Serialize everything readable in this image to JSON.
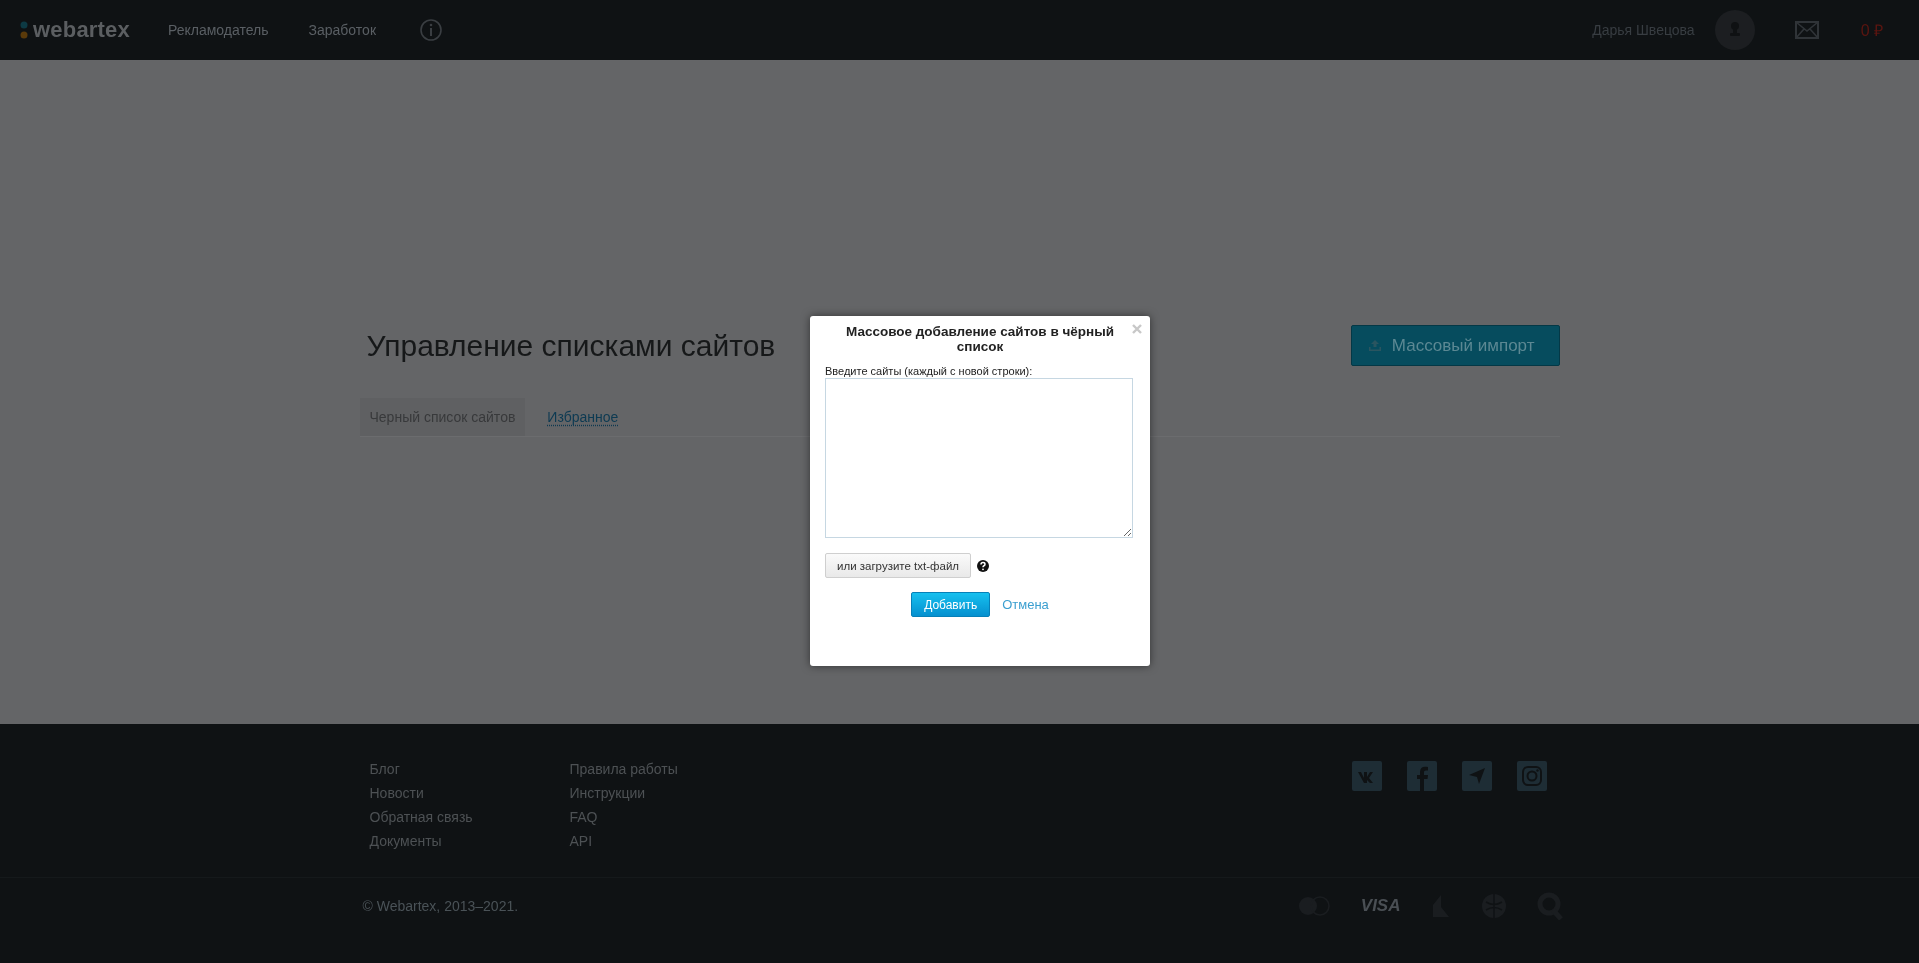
{
  "header": {
    "logo": "webartex",
    "nav": [
      {
        "label": "Рекламодатель"
      },
      {
        "label": "Заработок"
      }
    ],
    "user_name": "Дарья Швецова",
    "balance": "0 ₽"
  },
  "page": {
    "title": "Управление списками сайтов",
    "import_button": "Массовый импорт",
    "tabs": [
      {
        "label": "Черный список сайтов",
        "selected": true
      },
      {
        "label": "Избранное",
        "selected": false
      }
    ]
  },
  "dialog": {
    "title": "Массовое добавление сайтов в чёрный список",
    "field_label": "Введите сайты (каждый с новой строки):",
    "upload_button": "или загрузите txt-файл",
    "submit_button": "Добавить",
    "cancel_link": "Отмена"
  },
  "footer": {
    "columns": [
      [
        "Блог",
        "Новости",
        "Обратная связь",
        "Документы"
      ],
      [
        "Правила работы",
        "Инструкции",
        "FAQ",
        "API"
      ]
    ],
    "copyright": "© Webartex, 2013–2021.",
    "visa": "VISA"
  }
}
